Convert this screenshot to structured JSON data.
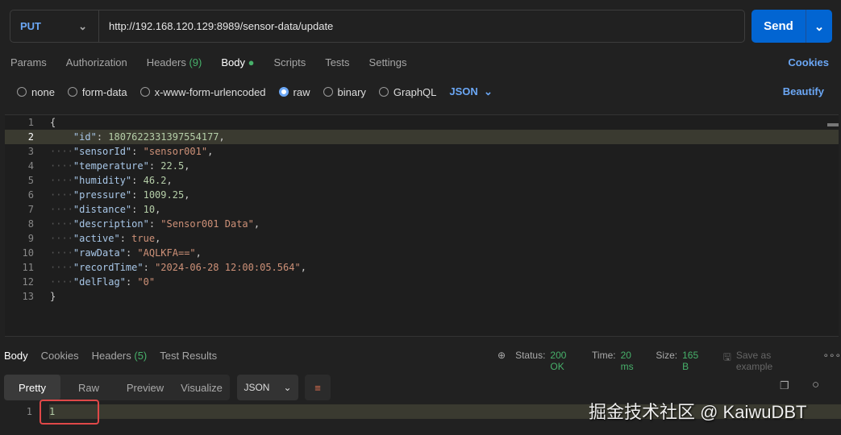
{
  "request": {
    "method": "PUT",
    "url": "http://192.168.120.129:8989/sensor-data/update",
    "send_label": "Send"
  },
  "tabs": [
    {
      "label": "Params"
    },
    {
      "label": "Authorization"
    },
    {
      "label": "Headers",
      "count": "(9)"
    },
    {
      "label": "Body"
    },
    {
      "label": "Scripts"
    },
    {
      "label": "Tests"
    },
    {
      "label": "Settings"
    }
  ],
  "cookies_label": "Cookies",
  "body_types": [
    "none",
    "form-data",
    "x-www-form-urlencoded",
    "raw",
    "binary",
    "GraphQL"
  ],
  "body_format": "JSON",
  "beautify_label": "Beautify",
  "code_lines": [
    [
      [
        "p",
        "{"
      ]
    ],
    [
      [
        "p",
        "    "
      ],
      [
        "k",
        "\"id\""
      ],
      [
        "p",
        ": "
      ],
      [
        "n",
        "1807622331397554177"
      ],
      [
        "p",
        ","
      ]
    ],
    [
      [
        "d",
        "····"
      ],
      [
        "k",
        "\"sensorId\""
      ],
      [
        "p",
        ": "
      ],
      [
        "s",
        "\"sensor001\""
      ],
      [
        "p",
        ","
      ]
    ],
    [
      [
        "d",
        "····"
      ],
      [
        "k",
        "\"temperature\""
      ],
      [
        "p",
        ": "
      ],
      [
        "n",
        "22.5"
      ],
      [
        "p",
        ","
      ]
    ],
    [
      [
        "d",
        "····"
      ],
      [
        "k",
        "\"humidity\""
      ],
      [
        "p",
        ": "
      ],
      [
        "n",
        "46.2"
      ],
      [
        "p",
        ","
      ]
    ],
    [
      [
        "d",
        "····"
      ],
      [
        "k",
        "\"pressure\""
      ],
      [
        "p",
        ": "
      ],
      [
        "n",
        "1009.25"
      ],
      [
        "p",
        ","
      ]
    ],
    [
      [
        "d",
        "····"
      ],
      [
        "k",
        "\"distance\""
      ],
      [
        "p",
        ": "
      ],
      [
        "n",
        "10"
      ],
      [
        "p",
        ","
      ]
    ],
    [
      [
        "d",
        "····"
      ],
      [
        "k",
        "\"description\""
      ],
      [
        "p",
        ": "
      ],
      [
        "s",
        "\"Sensor001 Data\""
      ],
      [
        "p",
        ","
      ]
    ],
    [
      [
        "d",
        "····"
      ],
      [
        "k",
        "\"active\""
      ],
      [
        "p",
        ": "
      ],
      [
        "s",
        "true"
      ],
      [
        "p",
        ","
      ]
    ],
    [
      [
        "d",
        "····"
      ],
      [
        "k",
        "\"rawData\""
      ],
      [
        "p",
        ": "
      ],
      [
        "s",
        "\"AQLKFA==\""
      ],
      [
        "p",
        ","
      ]
    ],
    [
      [
        "d",
        "····"
      ],
      [
        "k",
        "\"recordTime\""
      ],
      [
        "p",
        ": "
      ],
      [
        "s",
        "\"2024-06-28 12:00:05.564\""
      ],
      [
        "p",
        ","
      ]
    ],
    [
      [
        "d",
        "····"
      ],
      [
        "k",
        "\"delFlag\""
      ],
      [
        "p",
        ": "
      ],
      [
        "s",
        "\"0\""
      ]
    ],
    [
      [
        "p",
        "}"
      ]
    ]
  ],
  "response": {
    "tabs": [
      {
        "label": "Body"
      },
      {
        "label": "Cookies"
      },
      {
        "label": "Headers",
        "count": "(5)"
      },
      {
        "label": "Test Results"
      }
    ],
    "status_label": "Status:",
    "status": "200 OK",
    "time_label": "Time:",
    "time": "20 ms",
    "size_label": "Size:",
    "size": "165 B",
    "save_example": "Save as example",
    "views": [
      "Pretty",
      "Raw",
      "Preview",
      "Visualize"
    ],
    "format": "JSON",
    "line_number": "1",
    "value": "1"
  },
  "watermark": "掘金技术社区 @ KaiwuDBT"
}
